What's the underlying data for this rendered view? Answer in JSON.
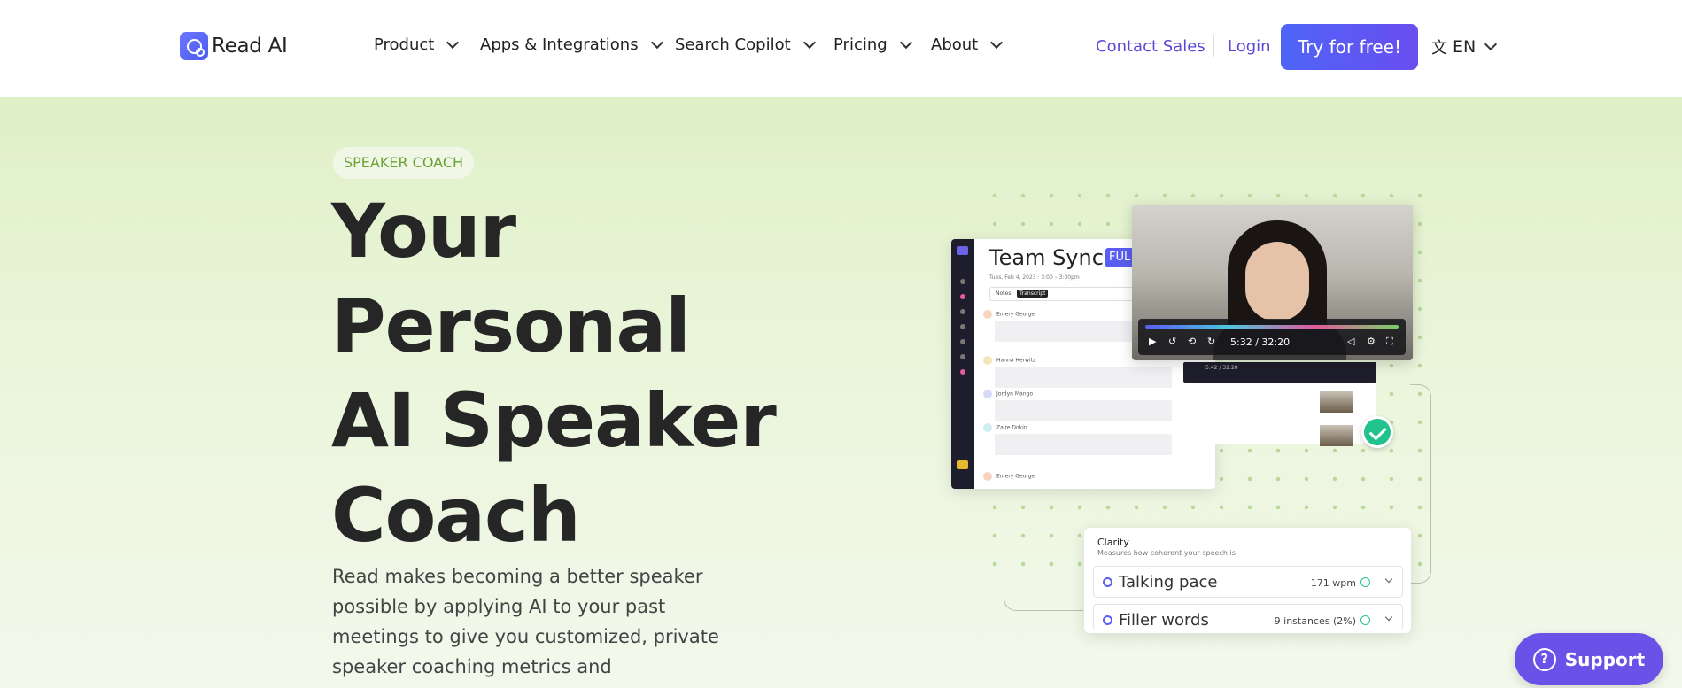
{
  "nav": {
    "logo_text": "Read AI",
    "items": [
      {
        "label": "Product"
      },
      {
        "label": "Apps & Integrations"
      },
      {
        "label": "Search Copilot"
      },
      {
        "label": "Pricing"
      },
      {
        "label": "About"
      }
    ],
    "contact_sales": "Contact Sales",
    "login": "Login",
    "cta": "Try for free!",
    "language": "EN",
    "language_icon": "translate-icon"
  },
  "hero": {
    "badge": "SPEAKER COACH",
    "headline_lines": [
      "Your",
      "Personal",
      "AI Speaker",
      "Coach"
    ],
    "subtext": "Read makes becoming a better speaker possible by applying AI to your past meetings to give you customized, private speaker coaching metrics and"
  },
  "illustration": {
    "app": {
      "title": "Team Sync",
      "badge": "FUL",
      "date": "Tues, Feb 4, 2023 · 3:00 – 3:30pm",
      "tab_notes": "Notes",
      "tab_transcript": "Transcript",
      "speakers": [
        "Emery George",
        "Hanna Herwitz",
        "Jordyn Mango",
        "Zaire Dokin",
        "Emery George"
      ]
    },
    "video": {
      "time": "5:32 / 32:20"
    },
    "mini_player_time": "5:42 / 32:20",
    "metrics_card": {
      "title": "Clarity",
      "description": "Measures how coherent your speech is",
      "rows": [
        {
          "label": "Talking pace",
          "value": "171 wpm"
        },
        {
          "label": "Filler words",
          "value": "9 instances (2%)"
        }
      ]
    }
  },
  "support": {
    "label": "Support",
    "icon": "question-icon"
  }
}
